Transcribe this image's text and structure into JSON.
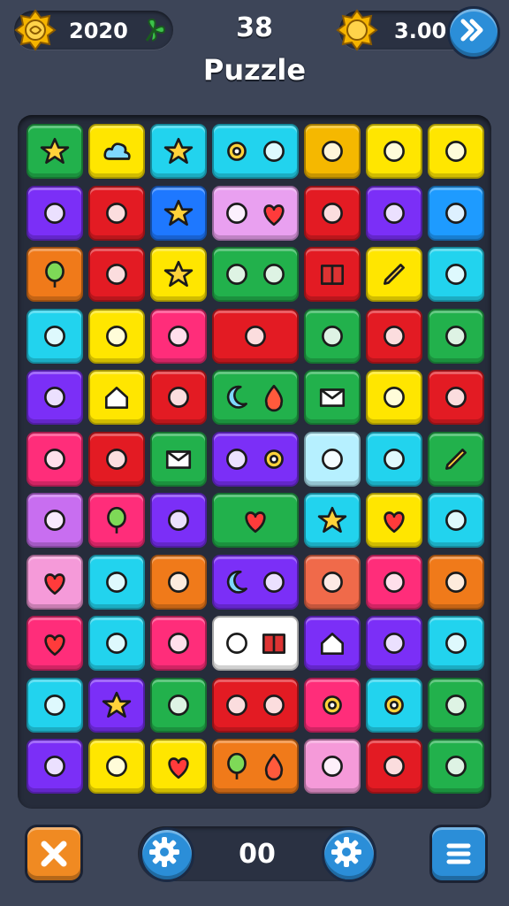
{
  "hud": {
    "coins_value": "2020",
    "moves_value": "38",
    "multiplier_value": "3.00",
    "title": "Puzzle"
  },
  "footer": {
    "score_value": "00"
  },
  "board": {
    "rows": [
      [
        {
          "color": "#22b14c",
          "icon": "star-icon"
        },
        {
          "color": "#ffe600",
          "icon": "cloud-icon"
        },
        {
          "color": "#22d3ee",
          "icon": "star-icon"
        },
        {
          "color": "#22d3ee",
          "icons": [
            "gear-icon",
            "pin-icon"
          ]
        },
        {
          "color": "#f5b800",
          "icon": "keyhole-icon"
        },
        {
          "color": "#ffe600",
          "icon": "ghost-icon"
        },
        {
          "color": "#ffe600",
          "icon": "ghost-icon"
        }
      ],
      [
        {
          "color": "#7b2ff7",
          "icon": "paper-plane-icon"
        },
        {
          "color": "#e31b23",
          "icon": "bandage-icon"
        },
        {
          "color": "#1e78ff",
          "icon": "star-icon"
        },
        {
          "color": "#e9a0f0",
          "icons": [
            "bubble-icon",
            "heart-icon"
          ]
        },
        {
          "color": "#e31b23",
          "icon": "mitten-icon"
        },
        {
          "color": "#7b2ff7",
          "icon": "map-icon"
        },
        {
          "color": "#1e9bff",
          "icon": "chat-icon"
        }
      ],
      [
        {
          "color": "#f07a1a",
          "icon": "balloon-icon"
        },
        {
          "color": "#e31b23",
          "icon": "brush-icon"
        },
        {
          "color": "#ffe600",
          "icon": "star-icon"
        },
        {
          "color": "#22b14c",
          "icons": [
            "pin-icon",
            "snail-icon"
          ]
        },
        {
          "color": "#e31b23",
          "icon": "book-icon"
        },
        {
          "color": "#ffe600",
          "icon": "pencil-icon"
        },
        {
          "color": "#22d3ee",
          "icon": "berry-icon"
        }
      ],
      [
        {
          "color": "#22d3ee",
          "icon": "lightning-icon"
        },
        {
          "color": "#ffe600",
          "icon": "sun-icon"
        },
        {
          "color": "#ff2d7a",
          "icon": "box-icon"
        },
        {
          "color": "#e31b23",
          "icons": [
            "planet-icon"
          ]
        },
        {
          "color": "#22b14c",
          "icon": "carrot-icon"
        },
        {
          "color": "#e31b23",
          "icon": "tv-icon"
        },
        {
          "color": "#22b14c",
          "icon": "puzzle-icon"
        }
      ],
      [
        {
          "color": "#7b2ff7",
          "icon": "koala-icon"
        },
        {
          "color": "#ffe600",
          "icon": "house-icon"
        },
        {
          "color": "#e31b23",
          "icon": "rocket-icon"
        },
        {
          "color": "#22b14c",
          "icons": [
            "moon-icon",
            "drop-icon"
          ]
        },
        {
          "color": "#22b14c",
          "icon": "envelope-icon"
        },
        {
          "color": "#ffe600",
          "icon": "cup-icon"
        },
        {
          "color": "#e31b23",
          "icon": "tag-icon"
        }
      ],
      [
        {
          "color": "#ff2d7a",
          "icon": "mask-icon"
        },
        {
          "color": "#e31b23",
          "icon": "candy-cane-icon"
        },
        {
          "color": "#22b14c",
          "icon": "envelope-icon"
        },
        {
          "color": "#7b2ff7",
          "icons": [
            "sparkle-icon",
            "gear-icon"
          ]
        },
        {
          "color": "#b6f0ff",
          "icon": "target-icon"
        },
        {
          "color": "#22d3ee",
          "icon": "ear-icon"
        },
        {
          "color": "#22b14c",
          "icon": "pencil-icon"
        }
      ],
      [
        {
          "color": "#c86ef0",
          "icon": "cookie-icon"
        },
        {
          "color": "#ff2d7a",
          "icon": "balloon-icon"
        },
        {
          "color": "#7b2ff7",
          "icon": "leaf-icon"
        },
        {
          "color": "#22b14c",
          "icons": [
            "heart-icon"
          ]
        },
        {
          "color": "#22d3ee",
          "icon": "star-icon"
        },
        {
          "color": "#ffe600",
          "icon": "heart-icon"
        },
        {
          "color": "#22d3ee",
          "icon": "swirl-icon"
        }
      ],
      [
        {
          "color": "#f59ad9",
          "icon": "heart-icon"
        },
        {
          "color": "#22d3ee",
          "icon": "apple-icon"
        },
        {
          "color": "#f07a1a",
          "icon": "picture-icon"
        },
        {
          "color": "#7b2ff7",
          "icons": [
            "moon-icon",
            "egg-icon"
          ]
        },
        {
          "color": "#f06a4a",
          "icon": "bag-icon"
        },
        {
          "color": "#ff2d7a",
          "icon": "phone-icon"
        },
        {
          "color": "#f07a1a",
          "icon": "bell-icon"
        }
      ],
      [
        {
          "color": "#ff2d7a",
          "icon": "heart-icon"
        },
        {
          "color": "#22d3ee",
          "icon": "ring-icon"
        },
        {
          "color": "#ff2d7a",
          "icon": "dot-icon"
        },
        {
          "color": "#ffffff",
          "icons": [
            "tile-icon",
            "book-icon"
          ]
        },
        {
          "color": "#7b2ff7",
          "icon": "house-icon"
        },
        {
          "color": "#7b2ff7",
          "icon": "play-icon"
        },
        {
          "color": "#22d3ee",
          "icon": "trophy-icon"
        }
      ],
      [
        {
          "color": "#22d3ee",
          "icon": "check-icon"
        },
        {
          "color": "#7b2ff7",
          "icon": "star-icon"
        },
        {
          "color": "#22b14c",
          "icon": "pause-icon"
        },
        {
          "color": "#e31b23",
          "icons": [
            "bulb-icon",
            "face-icon"
          ]
        },
        {
          "color": "#ff2d7a",
          "icon": "gear-icon"
        },
        {
          "color": "#22d3ee",
          "icon": "gear-icon"
        },
        {
          "color": "#22b14c",
          "icon": "picture-icon"
        }
      ],
      [
        {
          "color": "#7b2ff7",
          "icon": "cross-icon"
        },
        {
          "color": "#ffe600",
          "icon": "briefcase-icon"
        },
        {
          "color": "#ffe600",
          "icon": "heart-icon"
        },
        {
          "color": "#f07a1a",
          "icons": [
            "balloon-icon",
            "drop-icon"
          ]
        },
        {
          "color": "#f59ad9",
          "icon": "bottle-icon"
        },
        {
          "color": "#e31b23",
          "icon": "splat-icon"
        },
        {
          "color": "#22b14c",
          "icon": "fish-icon"
        }
      ]
    ]
  }
}
